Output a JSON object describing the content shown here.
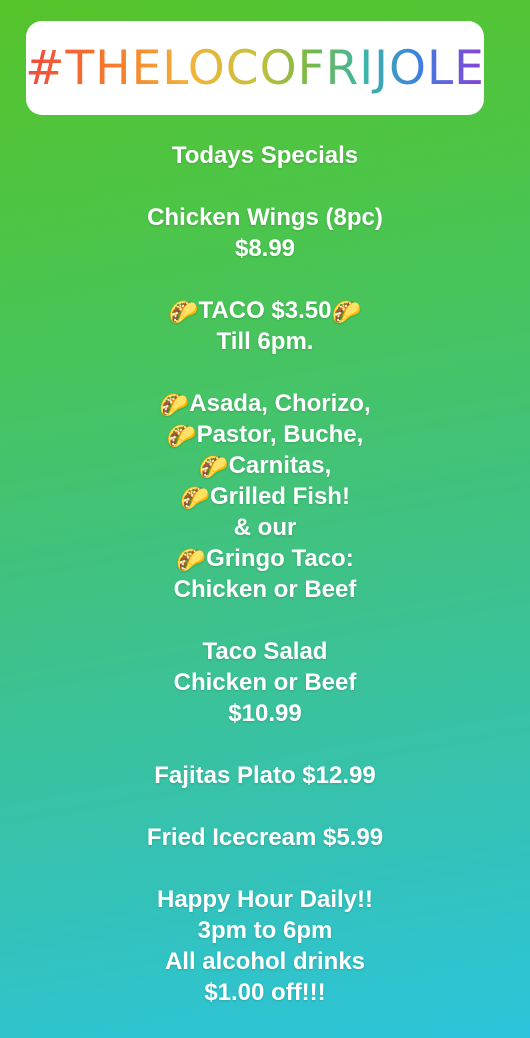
{
  "hashtag": {
    "text": "#THELOCOFRIJOLE"
  },
  "specials": {
    "heading": "Todays Specials",
    "wings": {
      "name": "Chicken Wings (8pc)",
      "price": "$8.99"
    },
    "taco_deal": {
      "icon": "taco-emoji",
      "label": "TACO $3.50",
      "time": "Till 6pm."
    },
    "taco_types": [
      {
        "icon": "taco-emoji",
        "text": "Asada, Chorizo,"
      },
      {
        "icon": "taco-emoji",
        "text": "Pastor, Buche,"
      },
      {
        "icon": "taco-emoji",
        "text": "Carnitas,"
      },
      {
        "icon": "taco-emoji",
        "text": "Grilled Fish!"
      }
    ],
    "and_our": "& our",
    "gringo": {
      "icon": "taco-emoji",
      "text": "Gringo Taco:",
      "options": "Chicken or Beef"
    },
    "salad": {
      "name": "Taco Salad",
      "options": "Chicken or Beef",
      "price": "$10.99"
    },
    "fajitas": "Fajitas Plato $12.99",
    "icecream": "Fried Icecream $5.99",
    "happy_hour": {
      "title": "Happy Hour Daily!!",
      "time": "3pm to 6pm",
      "line1": "All alcohol drinks",
      "line2": "$1.00 off!!!"
    }
  },
  "taco_glyph": "🌮",
  "colors": {
    "gradient_top": "#56c32a",
    "gradient_bottom": "#2cc4dc",
    "sticker_bg": "#ffffff"
  }
}
